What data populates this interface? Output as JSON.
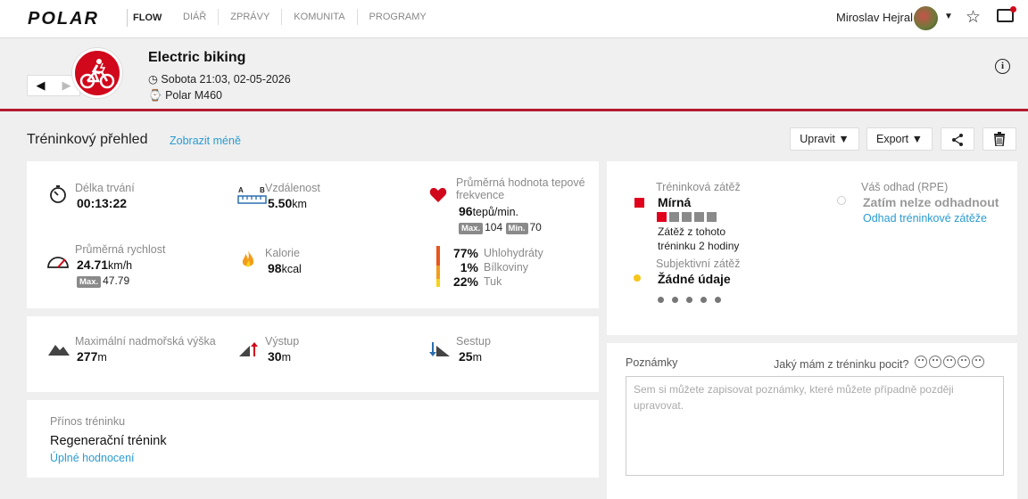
{
  "nav": {
    "brand": "POLAR",
    "product": "FLOW",
    "items": [
      "DIÁŘ",
      "ZPRÁVY",
      "KOMUNITA",
      "PROGRAMY"
    ],
    "user": "Miroslav Hejral"
  },
  "exercise": {
    "title": "Electric biking",
    "date": "Sobota 21:03, 02-05-2026",
    "device": "Polar M460",
    "sport_icon": "electric-bike-icon",
    "accent": "#d1081c"
  },
  "overview": {
    "title": "Tréninkový přehled",
    "show_less": "Zobrazit méně",
    "buttons": {
      "edit": "Upravit",
      "export": "Export"
    }
  },
  "summary": {
    "duration": {
      "label": "Délka trvání",
      "value": "00:13:22"
    },
    "distance": {
      "label": "Vzdálenost",
      "value": "5.50",
      "unit": "km"
    },
    "hr": {
      "label": "Průměrná hodnota tepové frekvence",
      "value": "96",
      "unit": "tepů/min.",
      "max_tag": "Max.",
      "max": "104",
      "min_tag": "Min.",
      "min": "70"
    },
    "speed": {
      "label": "Průměrná rychlost",
      "value": "24.71",
      "unit": "km/h",
      "max_tag": "Max.",
      "max": "47.79"
    },
    "calories": {
      "label": "Kalorie",
      "value": "98",
      "unit": "kcal"
    },
    "macros": [
      {
        "pct": "77%",
        "name": "Uhlohydráty",
        "color": "#e8561d"
      },
      {
        "pct": "1%",
        "name": "Bílkoviny",
        "color": "#f39c1c"
      },
      {
        "pct": "22%",
        "name": "Tuk",
        "color": "#f7d21a"
      }
    ]
  },
  "altitude": {
    "max": {
      "label": "Maximální nadmořská výška",
      "value": "277",
      "unit": "m"
    },
    "ascent": {
      "label": "Výstup",
      "value": "30",
      "unit": "m"
    },
    "descent": {
      "label": "Sestup",
      "value": "25",
      "unit": "m"
    }
  },
  "benefit": {
    "label": "Přínos tréninku",
    "value": "Regenerační trénink",
    "link": "Úplné hodnocení"
  },
  "load": {
    "training_label": "Tréninková zátěž",
    "training_value": "Mírná",
    "level": 1,
    "level_max": 5,
    "recovery_text": "Zátěž z tohoto tréninku 2 hodiny",
    "rpe_label": "Váš odhad (RPE)",
    "rpe_value": "Zatím nelze odhadnout",
    "rpe_link": "Odhad tréninkové zátěže",
    "subjective_label": "Subjektivní zátěž",
    "subjective_value": "Žádné údaje"
  },
  "notes": {
    "label": "Poznámky",
    "feeling_question": "Jaký mám z tréninku pocit?",
    "placeholder": "Sem si můžete zapisovat poznámky, které můžete případně později upravovat."
  }
}
